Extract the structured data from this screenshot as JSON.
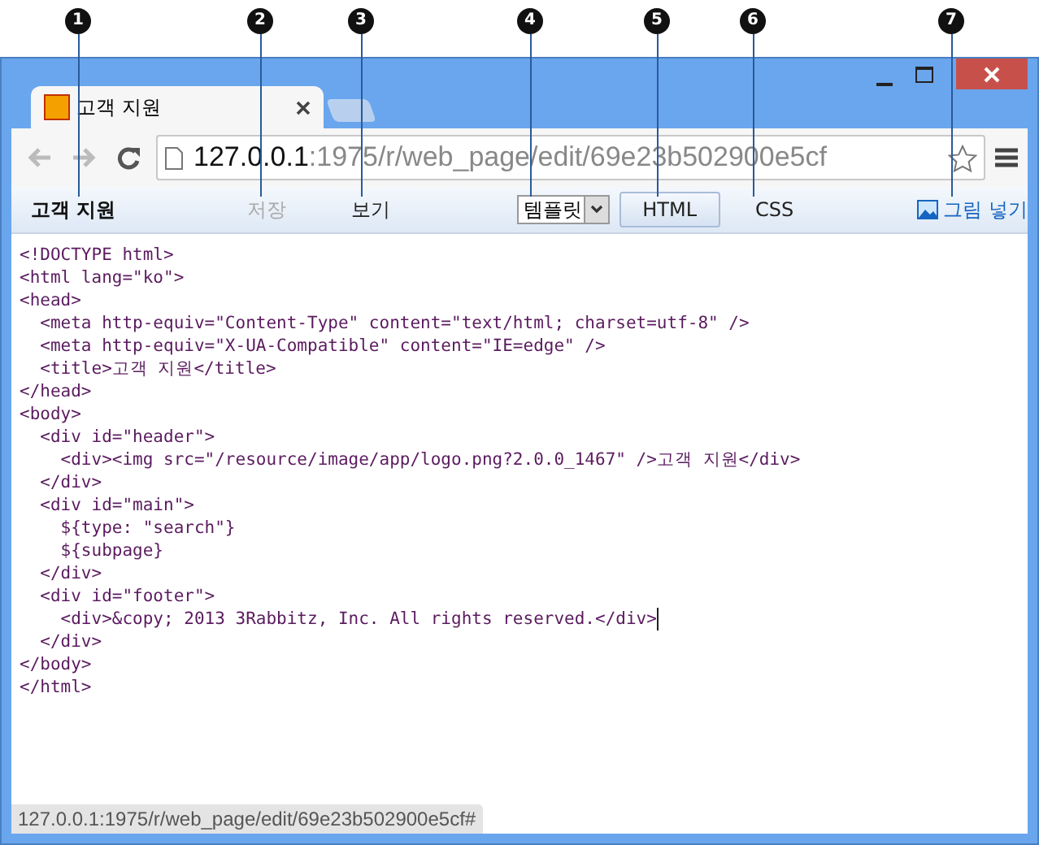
{
  "callouts": [
    "1",
    "2",
    "3",
    "4",
    "5",
    "6",
    "7"
  ],
  "browser_tab": {
    "title": "고객 지원",
    "selected": true
  },
  "address_bar": {
    "host": "127.0.0.1",
    "path": ":1975/r/web_page/edit/69e23b502900e5cf"
  },
  "toolbar": [
    {
      "kind": "title",
      "label": "고객 지원"
    },
    {
      "kind": "link",
      "label": "저장",
      "disabled": true
    },
    {
      "kind": "link",
      "label": "보기",
      "disabled": false
    },
    {
      "kind": "select",
      "label": "템플릿"
    },
    {
      "kind": "button",
      "label": "HTML",
      "selected": true
    },
    {
      "kind": "tab",
      "label": "CSS",
      "selected": false
    },
    {
      "kind": "image",
      "label": "그림 넣기"
    }
  ],
  "code_lines": [
    "<!DOCTYPE html>",
    "<html lang=\"ko\">",
    "<head>",
    "  <meta http-equiv=\"Content-Type\" content=\"text/html; charset=utf-8\" />",
    "  <meta http-equiv=\"X-UA-Compatible\" content=\"IE=edge\" />",
    "  <title>고객 지원</title>",
    "</head>",
    "<body>",
    "  <div id=\"header\">",
    "    <div><img src=\"/resource/image/app/logo.png?2.0.0_1467\" />고객 지원</div>",
    "  </div>",
    "  <div id=\"main\">",
    "    ${type: \"search\"}",
    "    ${subpage}",
    "  </div>",
    "  <div id=\"footer\">",
    "    <div>&copy; 2013 3Rabbitz, Inc. All rights reserved.</div>",
    "  </div>",
    "</body>",
    "</html>"
  ],
  "status_bar": {
    "text": "127.0.0.1:1975/r/web_page/edit/69e23b502900e5cf#"
  }
}
